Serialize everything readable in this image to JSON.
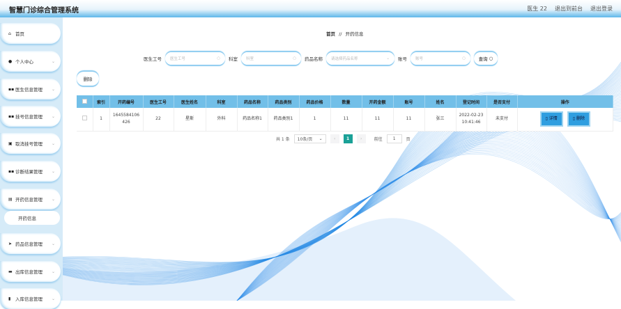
{
  "header": {
    "title": "智慧门诊综合管理系统",
    "user": "医生 22",
    "front": "退出到前台",
    "logout": "退出登录"
  },
  "sidebar": {
    "items": [
      {
        "label": "首页",
        "icon": "home-icon"
      },
      {
        "label": "个人中心",
        "icon": "user-icon"
      },
      {
        "label": "医生信息管理",
        "icon": "grid-icon"
      },
      {
        "label": "挂号信息管理",
        "icon": "grid-icon"
      },
      {
        "label": "取消挂号管理",
        "icon": "bag-icon"
      },
      {
        "label": "诊断结果管理",
        "icon": "grid-icon"
      },
      {
        "label": "开药信息管理",
        "icon": "list-icon"
      },
      {
        "label": "药品信息管理",
        "icon": "send-icon"
      },
      {
        "label": "出库信息管理",
        "icon": "card-icon"
      },
      {
        "label": "入库信息管理",
        "icon": "book-icon"
      }
    ],
    "sub": "开药信息"
  },
  "breadcrumb": {
    "home": "首页",
    "sep": "//",
    "current": "开药信息"
  },
  "search": {
    "fields": [
      {
        "label": "医生工号",
        "placeholder": "医生工号"
      },
      {
        "label": "科室",
        "placeholder": "科室"
      },
      {
        "label": "药品名称",
        "placeholder": "请选择药品名称"
      },
      {
        "label": "账号",
        "placeholder": "账号"
      }
    ],
    "query": "查询"
  },
  "delete_label": "删除",
  "table": {
    "headers": [
      "索引",
      "开药编号",
      "医生工号",
      "医生姓名",
      "科室",
      "药品名称",
      "药品类别",
      "药品价格",
      "数量",
      "开药金额",
      "账号",
      "姓名",
      "登记时间",
      "是否支付",
      "操作"
    ],
    "rows": [
      [
        "1",
        "1645584106426",
        "22",
        "星斯",
        "外科",
        "药品名称1",
        "药品类别1",
        "1",
        "11",
        "11",
        "11",
        "张三",
        "2022-02-23 10:41:46",
        "未支付"
      ]
    ],
    "detail": "详情",
    "delete": "删除"
  },
  "pager": {
    "total": "共 1 条",
    "size": "10条/页",
    "page": "1",
    "goto": "前往",
    "goto_value": "1",
    "unit": "页"
  }
}
